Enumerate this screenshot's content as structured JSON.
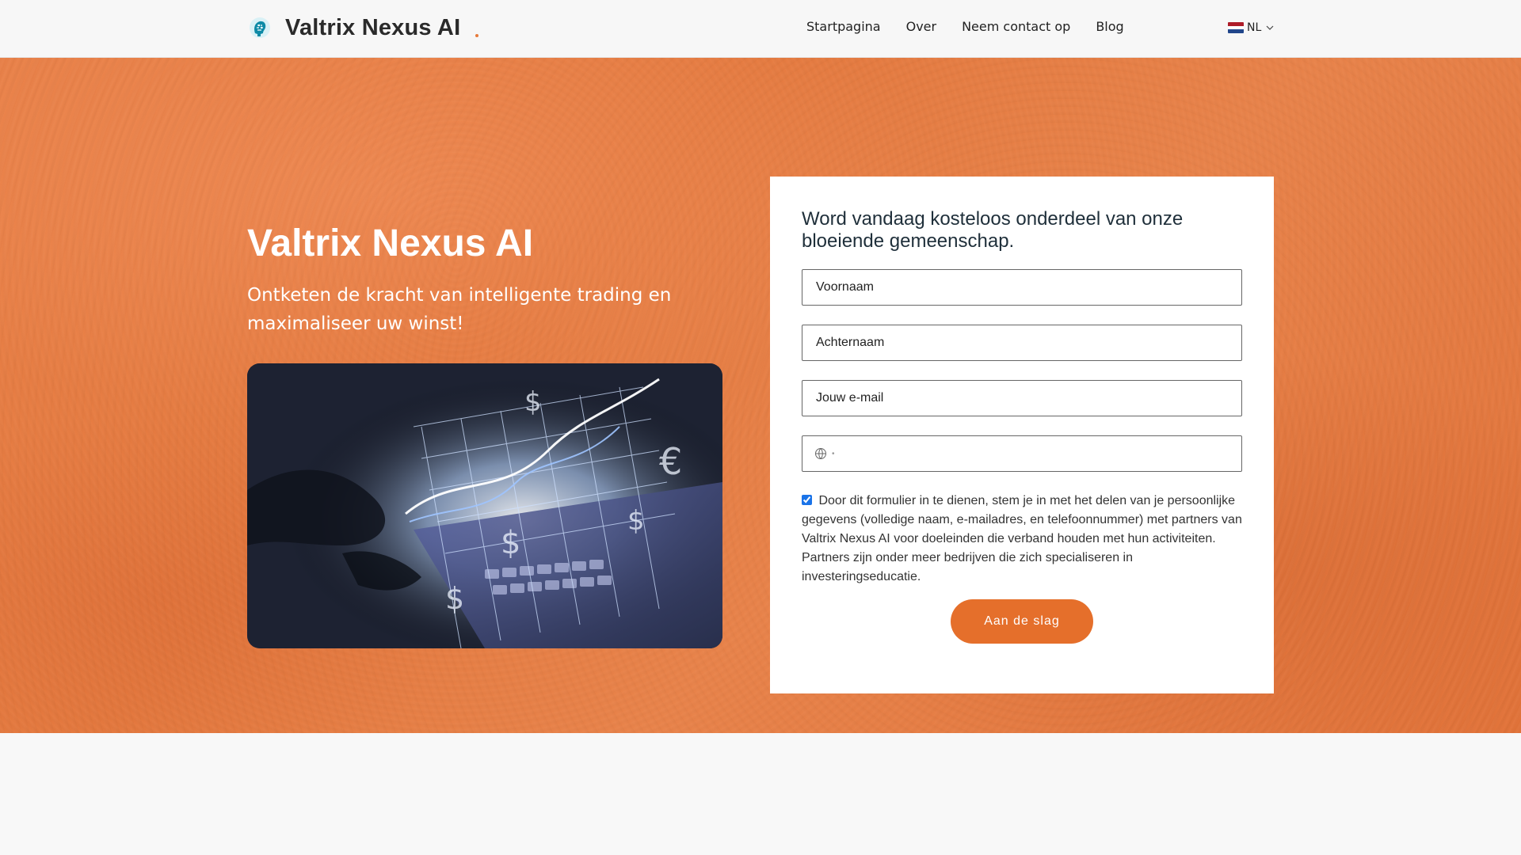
{
  "header": {
    "logo": {
      "icon": "brain-head-icon",
      "text": "Valtrix Nexus AI",
      "dot_color": "#e77a3a"
    },
    "nav": [
      {
        "label": "Startpagina"
      },
      {
        "label": "Over"
      },
      {
        "label": "Neem contact op"
      },
      {
        "label": "Blog"
      }
    ],
    "language": {
      "code": "NL",
      "flag": "netherlands-flag-icon",
      "chevron": "chevron-down-icon"
    }
  },
  "hero": {
    "title": "Valtrix Nexus AI",
    "subtitle": "Ontketen de kracht van intelligente trading en maximaliseer uw winst!",
    "image": "trading-laptop-image",
    "accent_color": "#e57a3f"
  },
  "signup": {
    "title": "Word vandaag kosteloos onderdeel van onze bloeiende gemeenschap.",
    "fields": {
      "first_name": {
        "placeholder": "Voornaam",
        "value": ""
      },
      "last_name": {
        "placeholder": "Achternaam",
        "value": ""
      },
      "email": {
        "placeholder": "Jouw e-mail",
        "value": ""
      },
      "phone": {
        "placeholder": "",
        "value": "",
        "prefix_icon": "globe-icon"
      }
    },
    "consent": {
      "checked": true,
      "text": "Door dit formulier in te dienen, stem je in met het delen van je persoonlijke gegevens (volledige naam, e-mailadres, en telefoonnummer) met partners van Valtrix Nexus AI voor doeleinden die verband houden met hun activiteiten. Partners zijn onder meer bedrijven die zich specialiseren in investeringseducatie."
    },
    "submit_label": "Aan de slag",
    "button_color": "#e56f2b"
  }
}
